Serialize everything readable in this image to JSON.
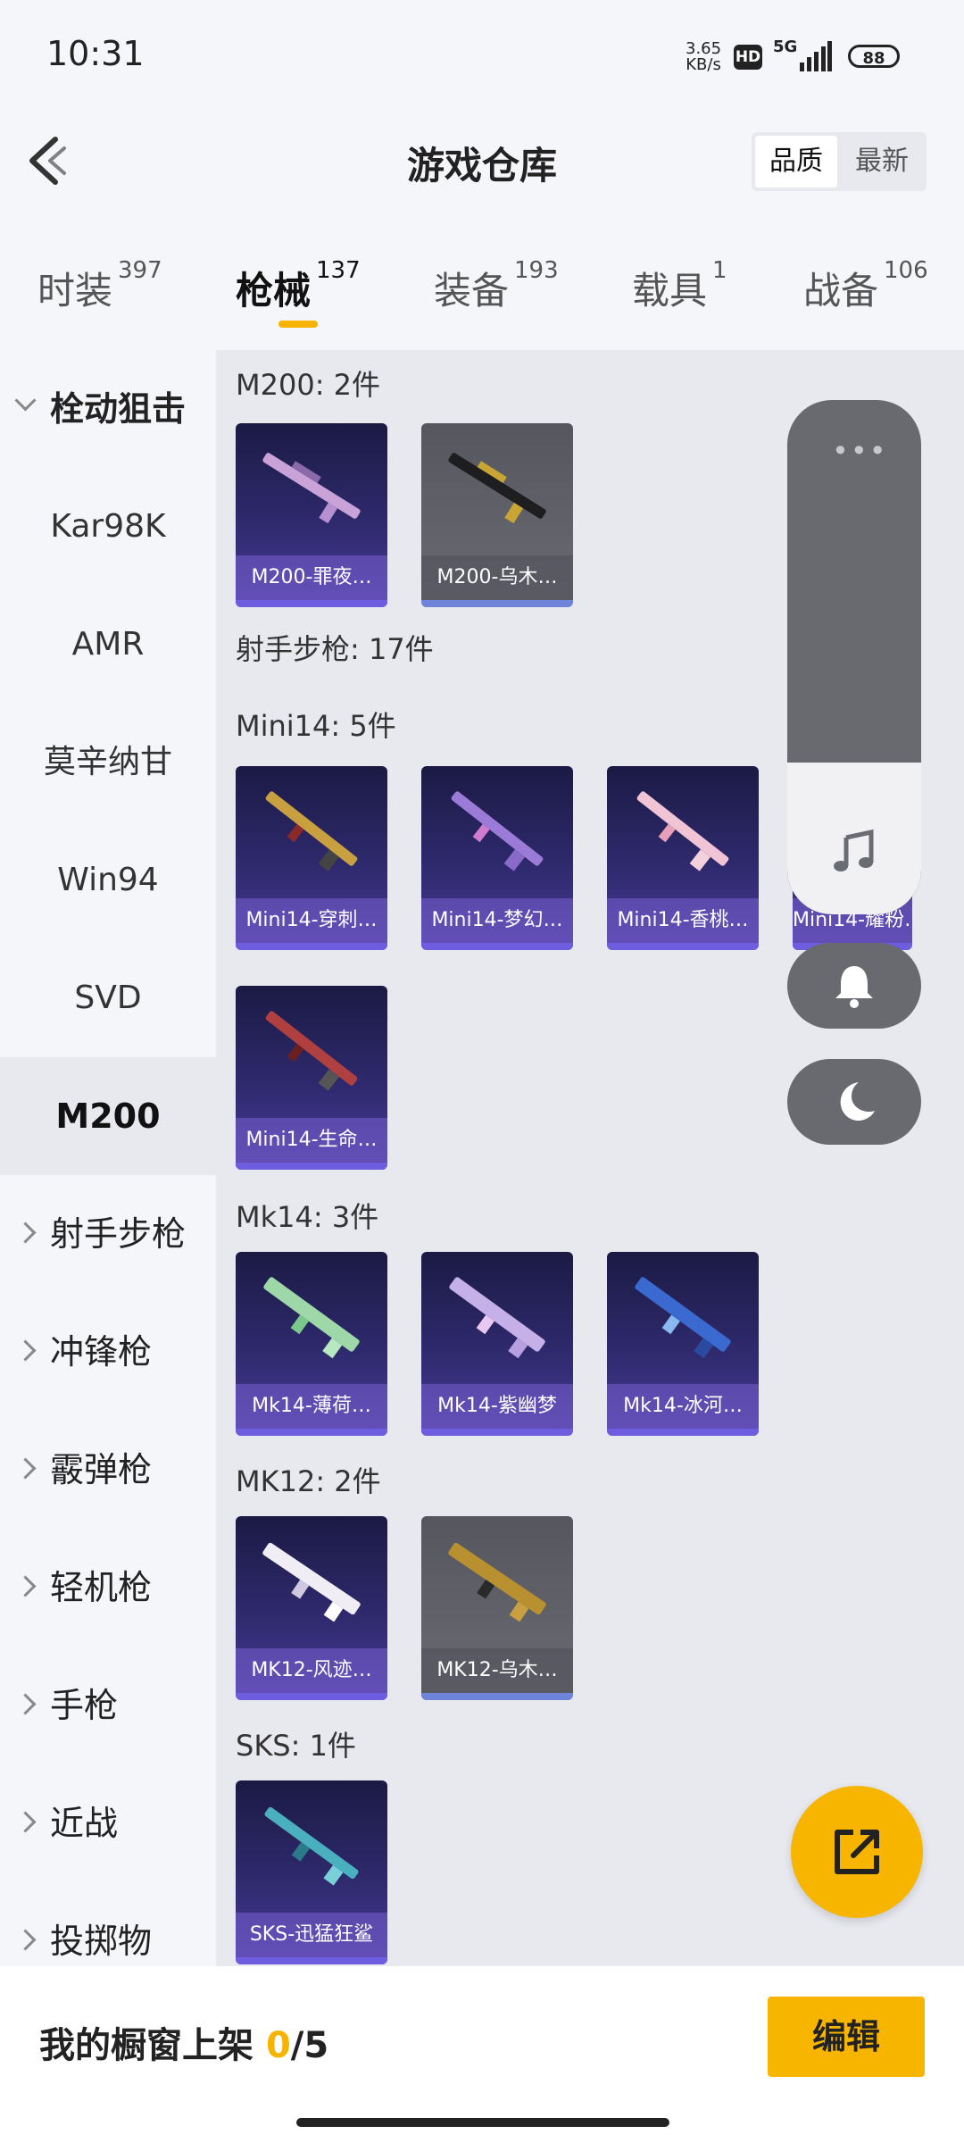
{
  "status_bar": {
    "time": "10:31",
    "net_speed_value": "3.65",
    "net_speed_unit": "KB/s",
    "hd": "HD",
    "network": "5G",
    "battery": "88"
  },
  "header": {
    "title": "游戏仓库",
    "sort_options": [
      "品质",
      "最新"
    ]
  },
  "tabs": [
    {
      "label": "时装",
      "count": "397"
    },
    {
      "label": "枪械",
      "count": "137"
    },
    {
      "label": "装备",
      "count": "193"
    },
    {
      "label": "载具",
      "count": "1"
    },
    {
      "label": "战备",
      "count": "106"
    }
  ],
  "sidebar": {
    "group_open": "栓动狙击",
    "sub_items": [
      "Kar98K",
      "AMR",
      "莫辛纳甘",
      "Win94",
      "SVD",
      "M200"
    ],
    "groups": [
      "射手步枪",
      "冲锋枪",
      "霰弹枪",
      "轻机枪",
      "手枪",
      "近战",
      "投掷物"
    ]
  },
  "sections": {
    "m200": {
      "title": "M200: 2件",
      "items": [
        "M200-罪夜…",
        "M200-乌木…"
      ]
    },
    "marksman": {
      "title": "射手步枪: 17件"
    },
    "mini14": {
      "title": "Mini14: 5件",
      "items": [
        "Mini14-穿刺…",
        "Mini14-梦幻…",
        "Mini14-香桃…",
        "Mini14-耀粉…",
        "Mini14-生命…"
      ]
    },
    "mk14": {
      "title": "Mk14: 3件",
      "items": [
        "Mk14-薄荷…",
        "Mk14-紫幽梦",
        "Mk14-冰河…"
      ]
    },
    "mk12": {
      "title": "MK12: 2件",
      "items": [
        "MK12-风迹…",
        "MK12-乌木…"
      ]
    },
    "sks": {
      "title": "SKS: 1件",
      "items": [
        "SKS-迅猛狂鲨"
      ]
    }
  },
  "bottom": {
    "shelf_label": "我的橱窗上架 ",
    "shelf_current": "0",
    "shelf_total": "/5",
    "edit_label": "编辑"
  },
  "colors": {
    "accent": "#f7b500",
    "card_purple": "#2f2a6e",
    "card_gray": "#5f6068"
  },
  "icons": {
    "back": "back-arrow-icon",
    "music": "music-note-icon",
    "bell": "bell-icon",
    "moon": "moon-icon",
    "share": "external-link-icon"
  }
}
